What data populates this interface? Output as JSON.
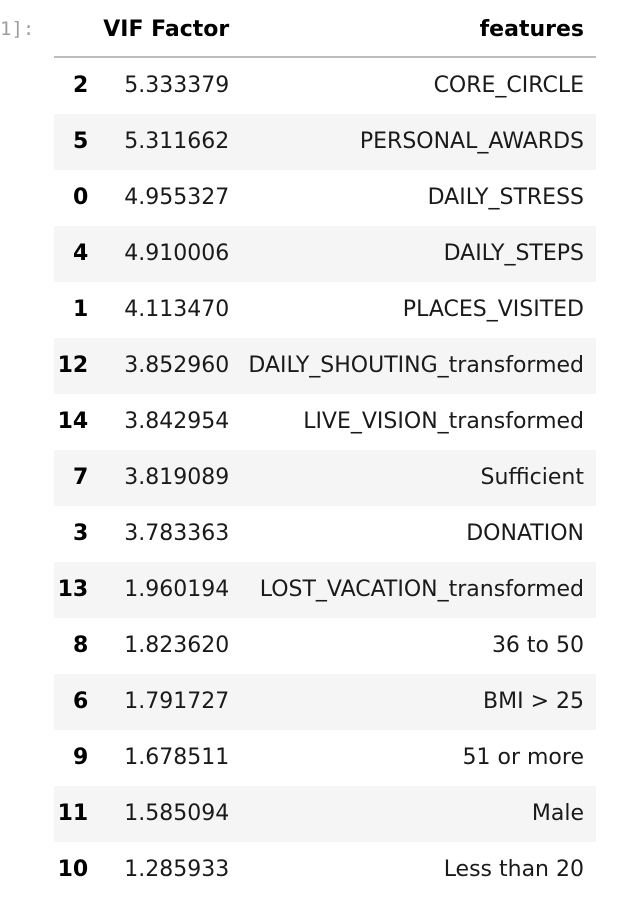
{
  "prompt": "1]:",
  "table": {
    "columns": [
      "",
      "VIF Factor",
      "features"
    ],
    "rows": [
      {
        "index": "2",
        "vif": "5.333379",
        "feature": "CORE_CIRCLE"
      },
      {
        "index": "5",
        "vif": "5.311662",
        "feature": "PERSONAL_AWARDS"
      },
      {
        "index": "0",
        "vif": "4.955327",
        "feature": "DAILY_STRESS"
      },
      {
        "index": "4",
        "vif": "4.910006",
        "feature": "DAILY_STEPS"
      },
      {
        "index": "1",
        "vif": "4.113470",
        "feature": "PLACES_VISITED"
      },
      {
        "index": "12",
        "vif": "3.852960",
        "feature": "DAILY_SHOUTING_transformed"
      },
      {
        "index": "14",
        "vif": "3.842954",
        "feature": "LIVE_VISION_transformed"
      },
      {
        "index": "7",
        "vif": "3.819089",
        "feature": "Sufficient"
      },
      {
        "index": "3",
        "vif": "3.783363",
        "feature": "DONATION"
      },
      {
        "index": "13",
        "vif": "1.960194",
        "feature": "LOST_VACATION_transformed"
      },
      {
        "index": "8",
        "vif": "1.823620",
        "feature": "36 to 50"
      },
      {
        "index": "6",
        "vif": "1.791727",
        "feature": "BMI > 25"
      },
      {
        "index": "9",
        "vif": "1.678511",
        "feature": "51 or more"
      },
      {
        "index": "11",
        "vif": "1.585094",
        "feature": "Male"
      },
      {
        "index": "10",
        "vif": "1.285933",
        "feature": "Less than 20"
      }
    ]
  },
  "colors": {
    "row_stripe": "#f5f5f5",
    "header_rule": "#bdbdbd",
    "prompt_text": "#9e9e9e"
  }
}
